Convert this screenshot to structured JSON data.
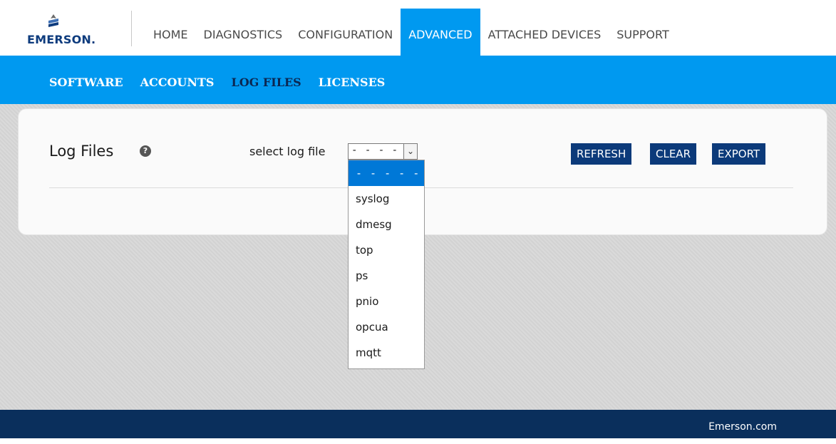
{
  "brand": {
    "name": "EMERSON."
  },
  "nav": {
    "items": [
      {
        "label": "HOME"
      },
      {
        "label": "DIAGNOSTICS"
      },
      {
        "label": "CONFIGURATION"
      },
      {
        "label": "ADVANCED",
        "active": true
      },
      {
        "label": "ATTACHED DEVICES"
      },
      {
        "label": "SUPPORT"
      }
    ]
  },
  "subnav": {
    "items": [
      {
        "label": "SOFTWARE"
      },
      {
        "label": "ACCOUNTS"
      },
      {
        "label": "LOG FILES",
        "active": true
      },
      {
        "label": "LICENSES"
      }
    ]
  },
  "panel": {
    "title": "Log Files",
    "help_icon": "question-circle-icon",
    "select_label": "select log file",
    "select_value": "- - - - -",
    "buttons": {
      "refresh": "REFRESH",
      "clear": "CLEAR",
      "export": "EXPORT"
    }
  },
  "dropdown": {
    "options": [
      "- - - - -",
      "syslog",
      "dmesg",
      "top",
      "ps",
      "pnio",
      "opcua",
      "mqtt"
    ],
    "selected_index": 0
  },
  "footer": {
    "link": "Emerson.com"
  },
  "colors": {
    "accent_blue": "#0099f0",
    "dark_navy": "#0a2f5c",
    "button_navy": "#0c3a7a",
    "selection_blue": "#0078d7"
  }
}
